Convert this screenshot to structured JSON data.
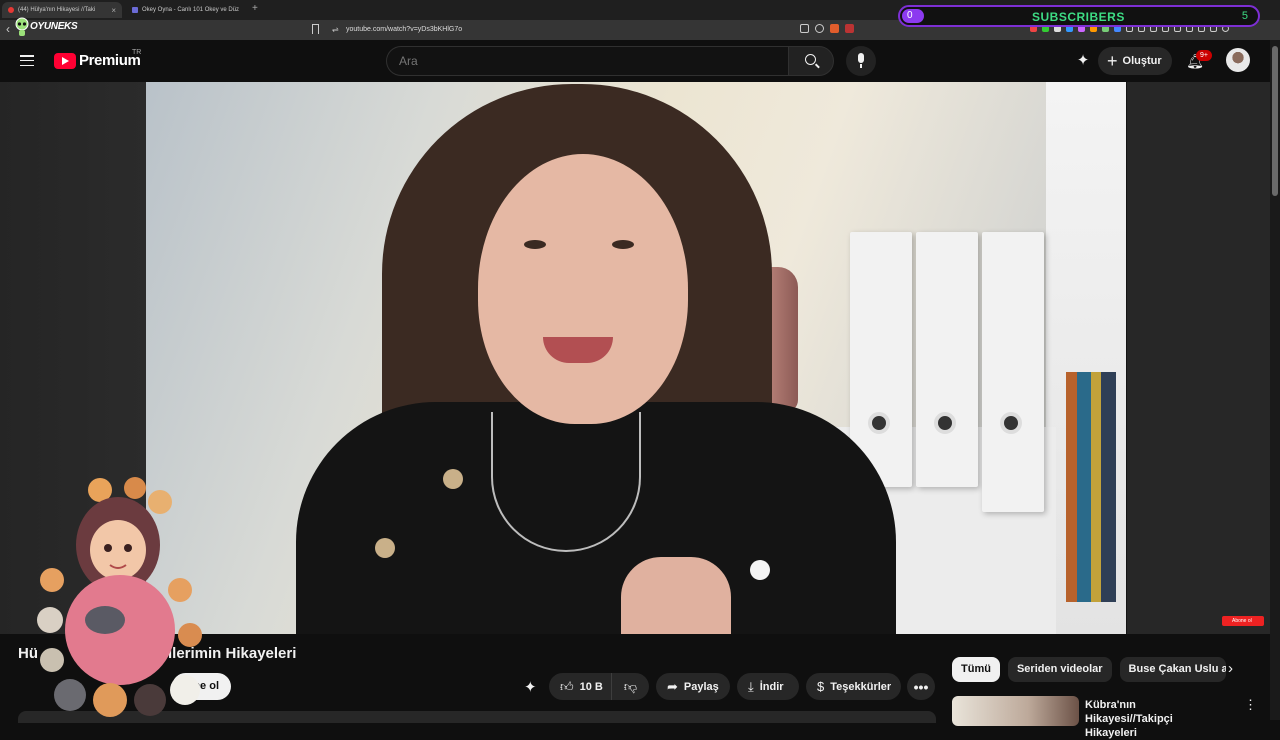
{
  "browser": {
    "tabs": [
      {
        "label": "(44) Hülya'nın Hikayesi //Taki",
        "active": true
      },
      {
        "label": "Okey Oyna - Canlı 101 Okey ve Düz",
        "active": false
      }
    ],
    "url": "youtube.com/watch?v=yDs3bKHlG7o"
  },
  "overlay": {
    "logo_text": "OYUNEKS",
    "subscribers": {
      "label": "SUBSCRIBERS",
      "current": "0",
      "goal": "5"
    }
  },
  "header": {
    "brand": "Premium",
    "country": "TR",
    "search_placeholder": "Ara",
    "create_label": "Oluştur",
    "notification_count": "9+"
  },
  "video": {
    "title_start": "Hü",
    "title_end": "ilerimin Hikayeleri",
    "subscribe_label": "ne ol",
    "end_chip": "Abone ol"
  },
  "actions": {
    "like_count": "10 B",
    "share": "Paylaş",
    "download": "İndir",
    "thanks": "Teşekkürler"
  },
  "sidebar": {
    "chips": [
      "Tümü",
      "Seriden videolar",
      "Buse Çakan Uslu adlı"
    ],
    "recommendation_title": "Kübra'nın Hikayesi//Takipçi Hikayeleri"
  },
  "icons": {
    "hamburger": "menu-icon",
    "search": "search-icon",
    "mic": "mic-icon",
    "bell": "bell-icon",
    "like": "thumbs-up-icon",
    "dislike": "thumbs-down-icon"
  },
  "colors": {
    "accent": "#ff0033",
    "chip_active": "#f1f1f1",
    "widget_border": "#7d2fd4",
    "widget_text": "#3ddc84"
  }
}
